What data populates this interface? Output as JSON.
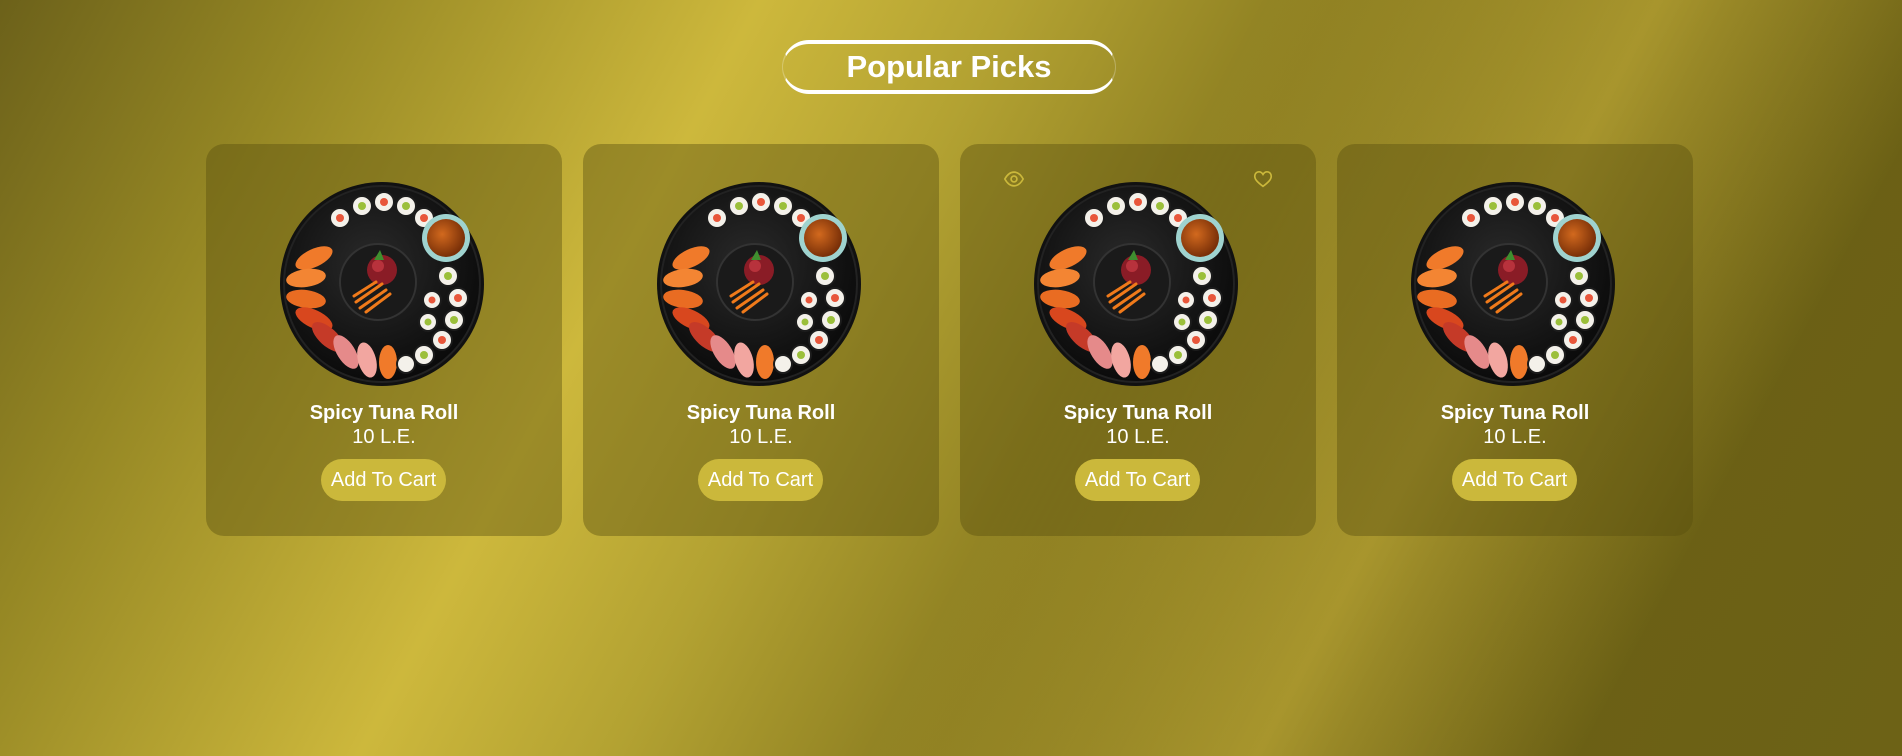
{
  "section": {
    "title": "Popular Picks"
  },
  "colors": {
    "accent": "#cbb83b",
    "text": "#ffffff",
    "card_background": "#584e0e"
  },
  "products": [
    {
      "name": "Spicy Tuna Roll",
      "price": "10 L.E.",
      "button_label": "Add To Cart",
      "image": "sushi-platter",
      "icons": []
    },
    {
      "name": "Spicy Tuna Roll",
      "price": "10 L.E.",
      "button_label": "Add To Cart",
      "image": "sushi-platter",
      "icons": []
    },
    {
      "name": "Spicy Tuna Roll",
      "price": "10 L.E.",
      "button_label": "Add To Cart",
      "image": "sushi-platter",
      "icons": [
        "eye-icon",
        "heart-icon"
      ]
    },
    {
      "name": "Spicy Tuna Roll",
      "price": "10 L.E.",
      "button_label": "Add To Cart",
      "image": "sushi-platter",
      "icons": []
    }
  ]
}
